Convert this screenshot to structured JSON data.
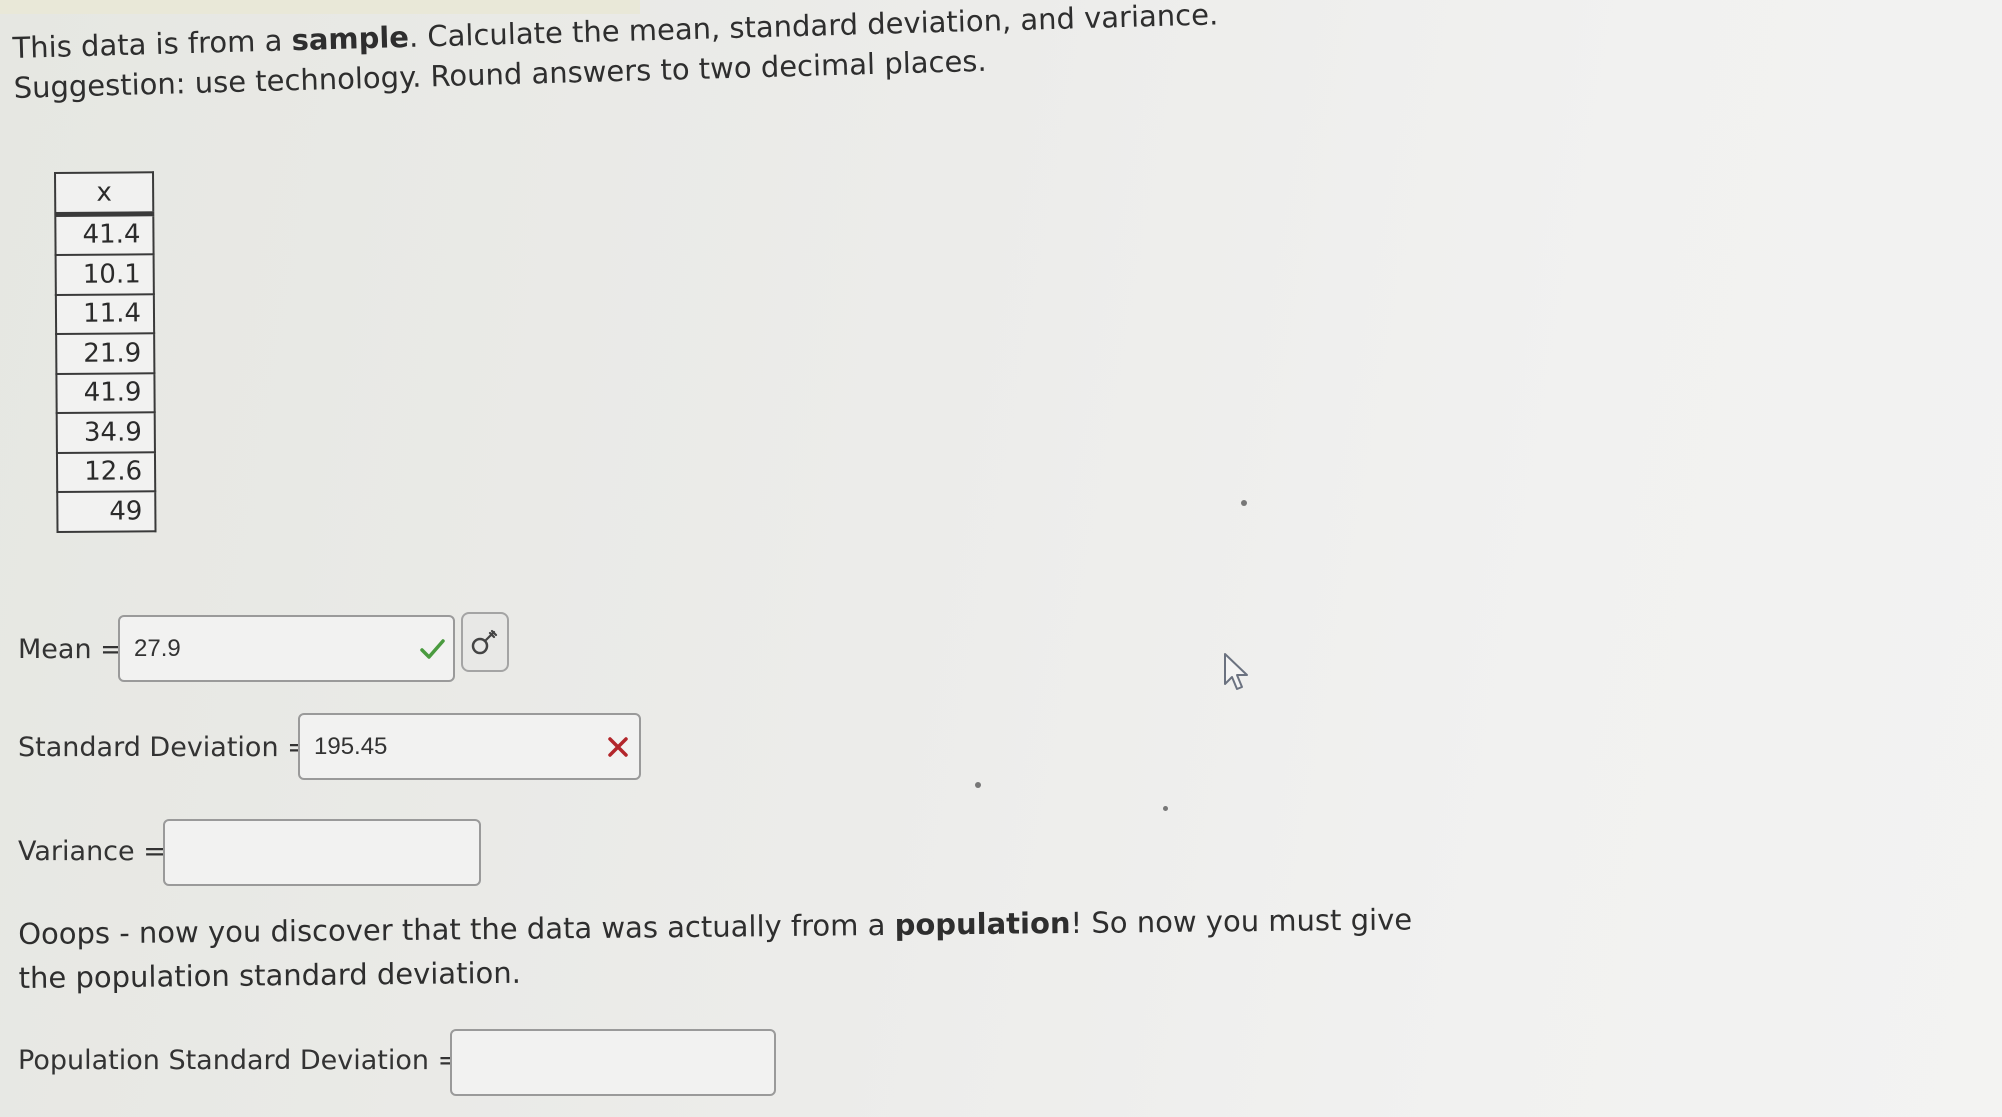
{
  "question": {
    "part1": "This data is from a ",
    "bold1": "sample",
    "part2": ". Calculate the mean, standard deviation, and variance. Suggestion: use technology. Round answers to two decimal places."
  },
  "table": {
    "header": "x",
    "values": [
      "41.4",
      "10.1",
      "11.4",
      "21.9",
      "41.9",
      "34.9",
      "12.6",
      "49"
    ]
  },
  "mean": {
    "label": "Mean =",
    "value": "27.9",
    "status": "correct"
  },
  "std_dev": {
    "label": "Standard Deviation =",
    "value": "195.45",
    "status": "incorrect"
  },
  "variance": {
    "label": "Variance =",
    "value": ""
  },
  "note": {
    "part1": "Ooops - now you discover that the data was actually from a ",
    "bold1": "population",
    "part2": "! So now you must give the population standard deviation."
  },
  "population_std_dev": {
    "label": "Population Standard Deviation =",
    "value": ""
  },
  "colors": {
    "correct": "#4a9b3f",
    "incorrect": "#b3262b"
  }
}
